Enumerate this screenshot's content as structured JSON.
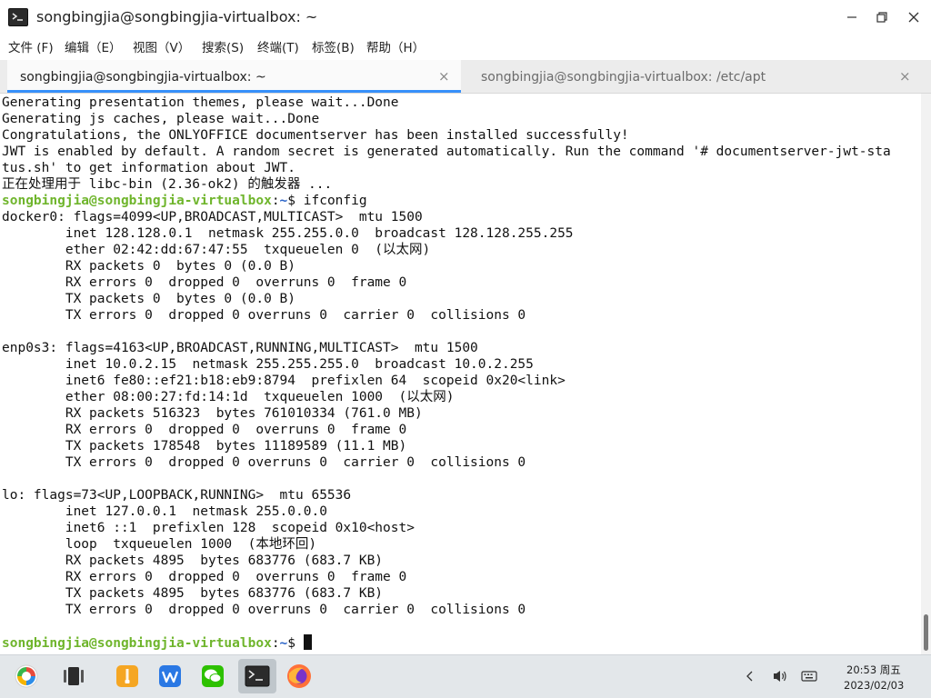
{
  "window": {
    "title": "songbingjia@songbingjia-virtualbox: ~"
  },
  "menu": [
    "文件 (F)",
    "编辑（E）",
    "视图（V）",
    "搜索(S)",
    "终端(T)",
    "标签(B)",
    "帮助（H）"
  ],
  "tabs": [
    {
      "label": "songbingjia@songbingjia-virtualbox: ~",
      "close": "×"
    },
    {
      "label": "songbingjia@songbingjia-virtualbox: /etc/apt",
      "close": "×"
    }
  ],
  "prompt": {
    "user": "songbingjia@songbingjia-virtualbox",
    "path": "~",
    "symbol": "$ "
  },
  "terminal_lines": [
    "Generating presentation themes, please wait...Done",
    "Generating js caches, please wait...Done",
    "Congratulations, the ONLYOFFICE documentserver has been installed successfully!",
    "JWT is enabled by default. A random secret is generated automatically. Run the command '# documentserver-jwt-sta",
    "tus.sh' to get information about JWT.",
    "正在处理用于 libc-bin (2.36-ok2) 的触发器 ...",
    "ifconfig",
    "docker0: flags=4099<UP,BROADCAST,MULTICAST>  mtu 1500",
    "        inet 128.128.0.1  netmask 255.255.0.0  broadcast 128.128.255.255",
    "        ether 02:42:dd:67:47:55  txqueuelen 0  (以太网)",
    "        RX packets 0  bytes 0 (0.0 B)",
    "        RX errors 0  dropped 0  overruns 0  frame 0",
    "        TX packets 0  bytes 0 (0.0 B)",
    "        TX errors 0  dropped 0 overruns 0  carrier 0  collisions 0",
    "",
    "enp0s3: flags=4163<UP,BROADCAST,RUNNING,MULTICAST>  mtu 1500",
    "        inet 10.0.2.15  netmask 255.255.255.0  broadcast 10.0.2.255",
    "        inet6 fe80::ef21:b18:eb9:8794  prefixlen 64  scopeid 0x20<link>",
    "        ether 08:00:27:fd:14:1d  txqueuelen 1000  (以太网)",
    "        RX packets 516323  bytes 761010334 (761.0 MB)",
    "        RX errors 0  dropped 0  overruns 0  frame 0",
    "        TX packets 178548  bytes 11189589 (11.1 MB)",
    "        TX errors 0  dropped 0 overruns 0  carrier 0  collisions 0",
    "",
    "lo: flags=73<UP,LOOPBACK,RUNNING>  mtu 65536",
    "        inet 127.0.0.1  netmask 255.0.0.0",
    "        inet6 ::1  prefixlen 128  scopeid 0x10<host>",
    "        loop  txqueuelen 1000  (本地环回)",
    "        RX packets 4895  bytes 683776 (683.7 KB)",
    "        RX errors 0  dropped 0  overruns 0  frame 0",
    "        TX packets 4895  bytes 683776 (683.7 KB)",
    "        TX errors 0  dropped 0 overruns 0  carrier 0  collisions 0",
    "",
    ""
  ],
  "taskbar": {
    "apps": [
      {
        "name": "start-menu-icon",
        "active": false
      },
      {
        "name": "multitask-view-icon",
        "active": false
      },
      {
        "name": "file-manager-icon",
        "active": false
      },
      {
        "name": "wps-office-icon",
        "active": false
      },
      {
        "name": "wechat-icon",
        "active": false
      },
      {
        "name": "terminal-icon",
        "active": true
      },
      {
        "name": "firefox-icon",
        "active": false
      }
    ],
    "time": "20:53 周五",
    "date": "2023/02/03"
  },
  "colors": {
    "prompt_user": "#6fb52c",
    "prompt_path": "#2a64c8",
    "tab_accent": "#3790fa"
  }
}
